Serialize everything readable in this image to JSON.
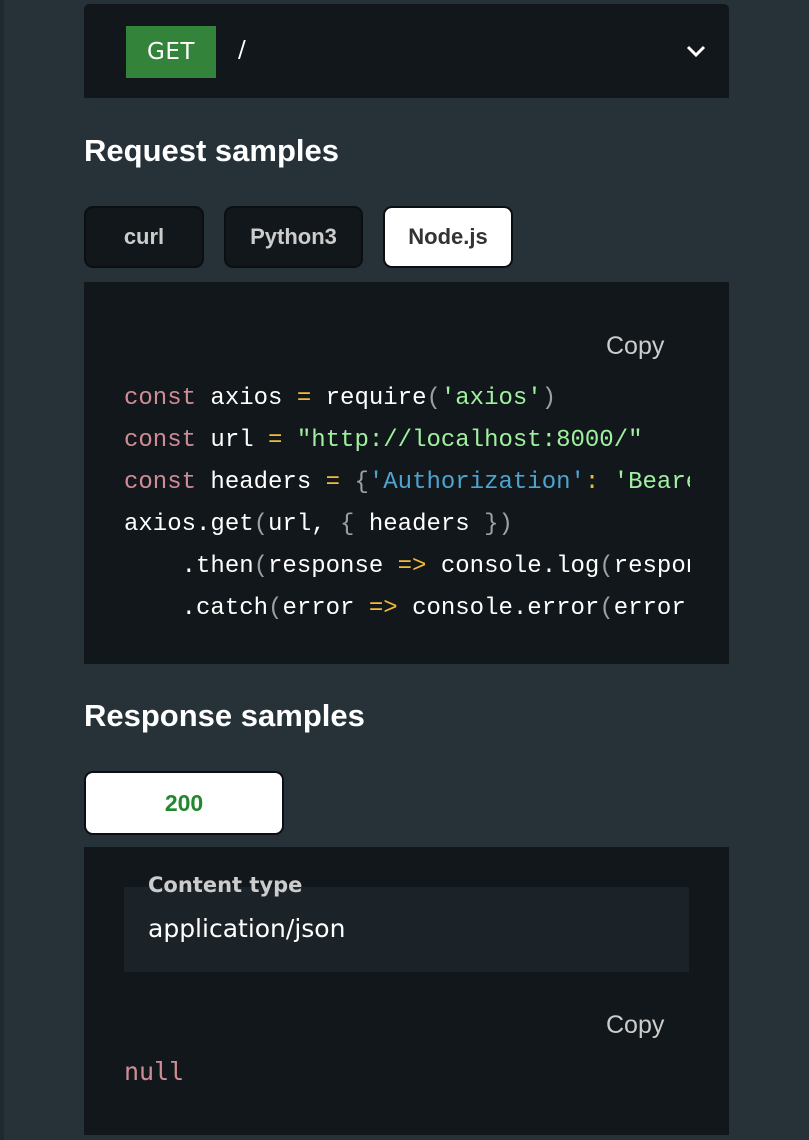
{
  "endpoint": {
    "method": "GET",
    "path": "/",
    "method_color": "#33843a",
    "expand_icon": "chevron-down-icon"
  },
  "request_samples": {
    "title": "Request samples",
    "tabs": [
      {
        "label": "curl",
        "active": false
      },
      {
        "label": "Python3",
        "active": false
      },
      {
        "label": "Node.js",
        "active": true
      }
    ],
    "copy_label": "Copy",
    "code_lines": [
      [
        {
          "t": "const",
          "c": "kw"
        },
        {
          "t": " axios ",
          "c": ""
        },
        {
          "t": "=",
          "c": "op"
        },
        {
          "t": " require",
          "c": ""
        },
        {
          "t": "(",
          "c": "punc"
        },
        {
          "t": "'axios'",
          "c": "str"
        },
        {
          "t": ")",
          "c": "punc"
        }
      ],
      [
        {
          "t": "const",
          "c": "kw"
        },
        {
          "t": " url ",
          "c": ""
        },
        {
          "t": "=",
          "c": "op"
        },
        {
          "t": " ",
          "c": ""
        },
        {
          "t": "\"http://localhost:8000/\"",
          "c": "str"
        }
      ],
      [
        {
          "t": "const",
          "c": "kw"
        },
        {
          "t": " headers ",
          "c": ""
        },
        {
          "t": "=",
          "c": "op"
        },
        {
          "t": " ",
          "c": ""
        },
        {
          "t": "{",
          "c": "punc"
        },
        {
          "t": "'Authorization'",
          "c": "key"
        },
        {
          "t": ":",
          "c": "op"
        },
        {
          "t": " ",
          "c": ""
        },
        {
          "t": "'Bearer",
          "c": "str"
        }
      ],
      [
        {
          "t": "axios.get",
          "c": ""
        },
        {
          "t": "(",
          "c": "punc"
        },
        {
          "t": "url, ",
          "c": ""
        },
        {
          "t": "{",
          "c": "punc"
        },
        {
          "t": " headers ",
          "c": ""
        },
        {
          "t": "})",
          "c": "punc"
        }
      ],
      [
        {
          "t": "    .then",
          "c": ""
        },
        {
          "t": "(",
          "c": "punc"
        },
        {
          "t": "response ",
          "c": ""
        },
        {
          "t": "=>",
          "c": "op"
        },
        {
          "t": " console.log",
          "c": ""
        },
        {
          "t": "(",
          "c": "punc"
        },
        {
          "t": "response",
          "c": ""
        }
      ],
      [
        {
          "t": "    .catch",
          "c": ""
        },
        {
          "t": "(",
          "c": "punc"
        },
        {
          "t": "error ",
          "c": ""
        },
        {
          "t": "=>",
          "c": "op"
        },
        {
          "t": " console.error",
          "c": ""
        },
        {
          "t": "(",
          "c": "punc"
        },
        {
          "t": "error",
          "c": ""
        }
      ]
    ]
  },
  "response_samples": {
    "title": "Response samples",
    "status_tab": "200",
    "status_color": "#22882e",
    "content_type_label": "Content type",
    "content_type_value": "application/json",
    "copy_label": "Copy",
    "body": "null"
  }
}
